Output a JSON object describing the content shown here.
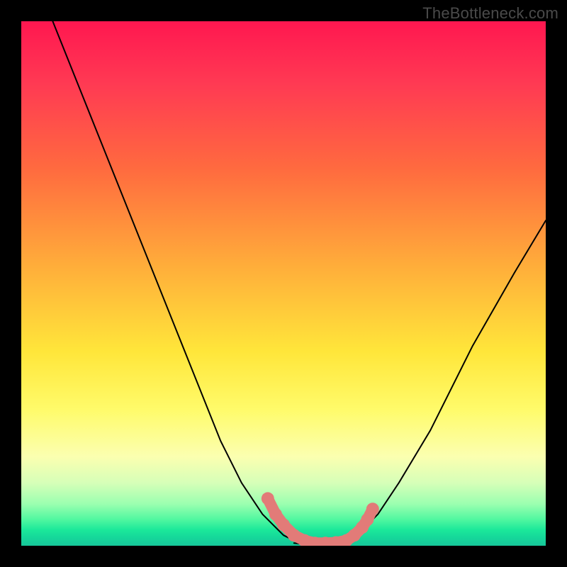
{
  "watermark": "TheBottleneck.com",
  "colors": {
    "frame_bg": "#000000",
    "curve_stroke": "#000000",
    "marker_fill": "#e27b78",
    "marker_stroke": "#c9605c"
  },
  "chart_data": {
    "type": "line",
    "title": "",
    "xlabel": "",
    "ylabel": "",
    "xlim": [
      0,
      100
    ],
    "ylim": [
      0,
      100
    ],
    "grid": false,
    "legend": false,
    "series": [
      {
        "name": "left-curve",
        "x": [
          6,
          14,
          22,
          30,
          38,
          42,
          46,
          48,
          50,
          52,
          54,
          56
        ],
        "y": [
          100,
          80,
          60,
          40,
          20,
          12,
          6,
          4,
          2,
          1,
          0.5,
          0
        ]
      },
      {
        "name": "right-curve",
        "x": [
          60,
          62,
          65,
          68,
          72,
          78,
          86,
          94,
          100
        ],
        "y": [
          0,
          1,
          3,
          6,
          12,
          22,
          38,
          52,
          62
        ]
      },
      {
        "name": "flat-bottom",
        "x": [
          52,
          54,
          56,
          58,
          60,
          62
        ],
        "y": [
          0.5,
          0.3,
          0.2,
          0.2,
          0.3,
          0.5
        ]
      }
    ],
    "markers": [
      {
        "x": 47,
        "y": 9
      },
      {
        "x": 48.5,
        "y": 6
      },
      {
        "x": 50,
        "y": 4
      },
      {
        "x": 52,
        "y": 2
      },
      {
        "x": 54,
        "y": 1
      },
      {
        "x": 56,
        "y": 0.5
      },
      {
        "x": 58,
        "y": 0.5
      },
      {
        "x": 60,
        "y": 0.6
      },
      {
        "x": 62,
        "y": 1
      },
      {
        "x": 63.5,
        "y": 2
      },
      {
        "x": 65,
        "y": 3.5
      },
      {
        "x": 66,
        "y": 5
      },
      {
        "x": 67,
        "y": 7
      }
    ]
  }
}
